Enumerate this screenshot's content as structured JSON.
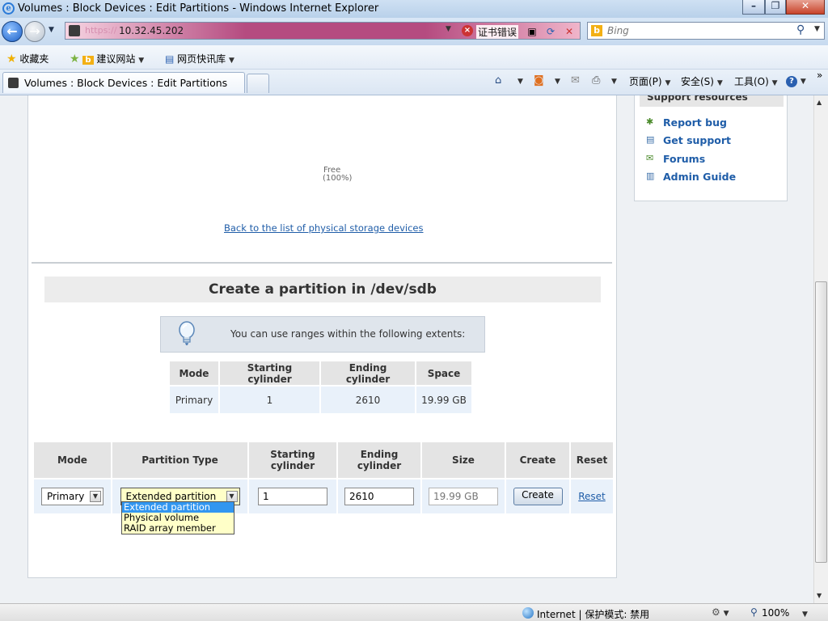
{
  "window": {
    "title": "Volumes : Block Devices : Edit Partitions - Windows Internet Explorer"
  },
  "address": {
    "scheme": "https://",
    "host": "10.32.45.202",
    "cert_error": "证书错误",
    "icon": "lock-error-icon"
  },
  "search": {
    "placeholder": "Bing"
  },
  "favorites": {
    "label": "收藏夹",
    "items": [
      "建议网站",
      "网页快讯库"
    ]
  },
  "tab": {
    "title": "Volumes : Block Devices : Edit Partitions"
  },
  "commands": {
    "page": "页面(P)",
    "safety": "安全(S)",
    "tools": "工具(O)"
  },
  "sidebar": {
    "heading": "Support resources",
    "links": [
      {
        "label": "Report bug",
        "icon": "bug-icon"
      },
      {
        "label": "Get support",
        "icon": "support-icon"
      },
      {
        "label": "Forums",
        "icon": "forums-icon"
      },
      {
        "label": "Admin Guide",
        "icon": "book-icon"
      }
    ]
  },
  "disk": {
    "free_label": "Free",
    "free_pct": "(100%)"
  },
  "back_link": "Back to the list of physical storage devices",
  "create": {
    "heading": "Create a partition in /dev/sdb",
    "hint": "You can use ranges within the following extents:"
  },
  "extents": {
    "headers": [
      "Mode",
      "Starting cylinder",
      "Ending cylinder",
      "Space"
    ],
    "rows": [
      [
        "Primary",
        "1",
        "2610",
        "19.99 GB"
      ]
    ]
  },
  "partition_form": {
    "headers": [
      "Mode",
      "Partition Type",
      "Starting cylinder",
      "Ending cylinder",
      "Size",
      "Create",
      "Reset"
    ],
    "mode_value": "Primary",
    "type_value": "Extended partition",
    "start_value": "1",
    "end_value": "2610",
    "size_placeholder": "19.99 GB",
    "create_label": "Create",
    "reset_label": "Reset"
  },
  "dropdown_options": [
    "Extended partition",
    "Physical volume",
    "RAID array member"
  ],
  "status": {
    "zone": "Internet | 保护模式: 禁用",
    "zoom": "100%"
  }
}
